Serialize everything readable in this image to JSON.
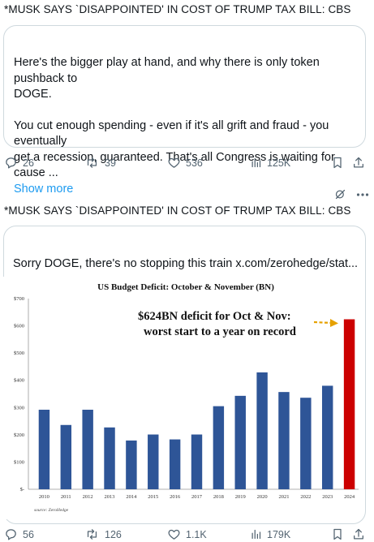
{
  "post1": {
    "headline": "*MUSK SAYS `DISAPPOINTED' IN COST OF TRUMP TAX BILL: CBS",
    "quote_line1": "Here's the bigger play at hand, and why there is only token pushback to",
    "quote_line2": "DOGE.",
    "quote_line3": "You cut enough spending - even if it's all grift and fraud - you eventually",
    "quote_line4": "get a recession, guaranteed. That's all Congress is waiting for cause ...",
    "show_more": "Show more",
    "actions": {
      "replies": "26",
      "reposts": "39",
      "likes": "536",
      "views": "125K"
    }
  },
  "post2": {
    "headline": "*MUSK SAYS `DISAPPOINTED' IN COST OF TRUMP TAX BILL: CBS",
    "quote_text": "Sorry DOGE, there's no stopping this train  x.com/zerohedge/stat...",
    "actions": {
      "replies": "56",
      "reposts": "126",
      "likes": "1.1K",
      "views": "179K"
    }
  },
  "chart_data": {
    "type": "bar",
    "title": "US Budget Deficit: October & November (BN)",
    "categories": [
      "2010",
      "2011",
      "2012",
      "2013",
      "2014",
      "2015",
      "2016",
      "2017",
      "2018",
      "2019",
      "2020",
      "2021",
      "2022",
      "2023",
      "2024"
    ],
    "values": [
      292,
      236,
      292,
      227,
      179,
      201,
      183,
      201,
      305,
      343,
      429,
      357,
      336,
      380,
      624
    ],
    "ylim": [
      0,
      700
    ],
    "yticks": [
      "$-",
      "$100",
      "$200",
      "$300",
      "$400",
      "$500",
      "$600",
      "$700"
    ],
    "bar_color": "#2e5597",
    "highlight_color": "#cc0000",
    "annotation_line1": "$624BN deficit for Oct & Nov:",
    "annotation_line2": "worst start to a year on record",
    "source": "source: ZeroHedge",
    "grid": false
  },
  "colors": {
    "accent": "#1d9bf0",
    "muted": "#536471",
    "border": "#cfd9de"
  }
}
